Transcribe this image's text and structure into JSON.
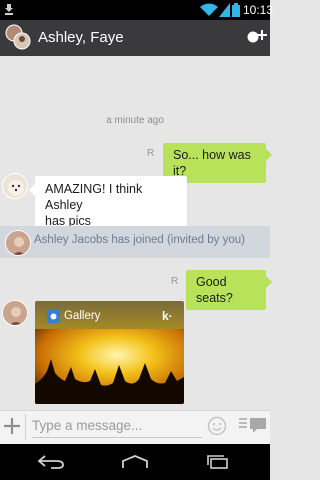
{
  "status_bar": {
    "time": "10:13"
  },
  "header": {
    "title": "Ashley, Faye"
  },
  "conversation": {
    "timestamp": "a minute ago",
    "messages": [
      {
        "side": "out",
        "text": "So... how was it?",
        "receipt": "R"
      },
      {
        "side": "in",
        "line1": "AMAZING! I think Ashley",
        "line2": "has pics"
      },
      {
        "side": "out",
        "text": "Good seats?",
        "receipt": "R"
      }
    ],
    "system": "Ashley Jacobs has joined (invited by you)",
    "gallery": {
      "label": "Gallery",
      "logo": "k·"
    }
  },
  "composer": {
    "placeholder": "Type a message..."
  },
  "colors": {
    "outgoing_bubble": "#b8e25a",
    "action_bar": "#3a3a3c",
    "status_accent": "#33b5e5"
  }
}
